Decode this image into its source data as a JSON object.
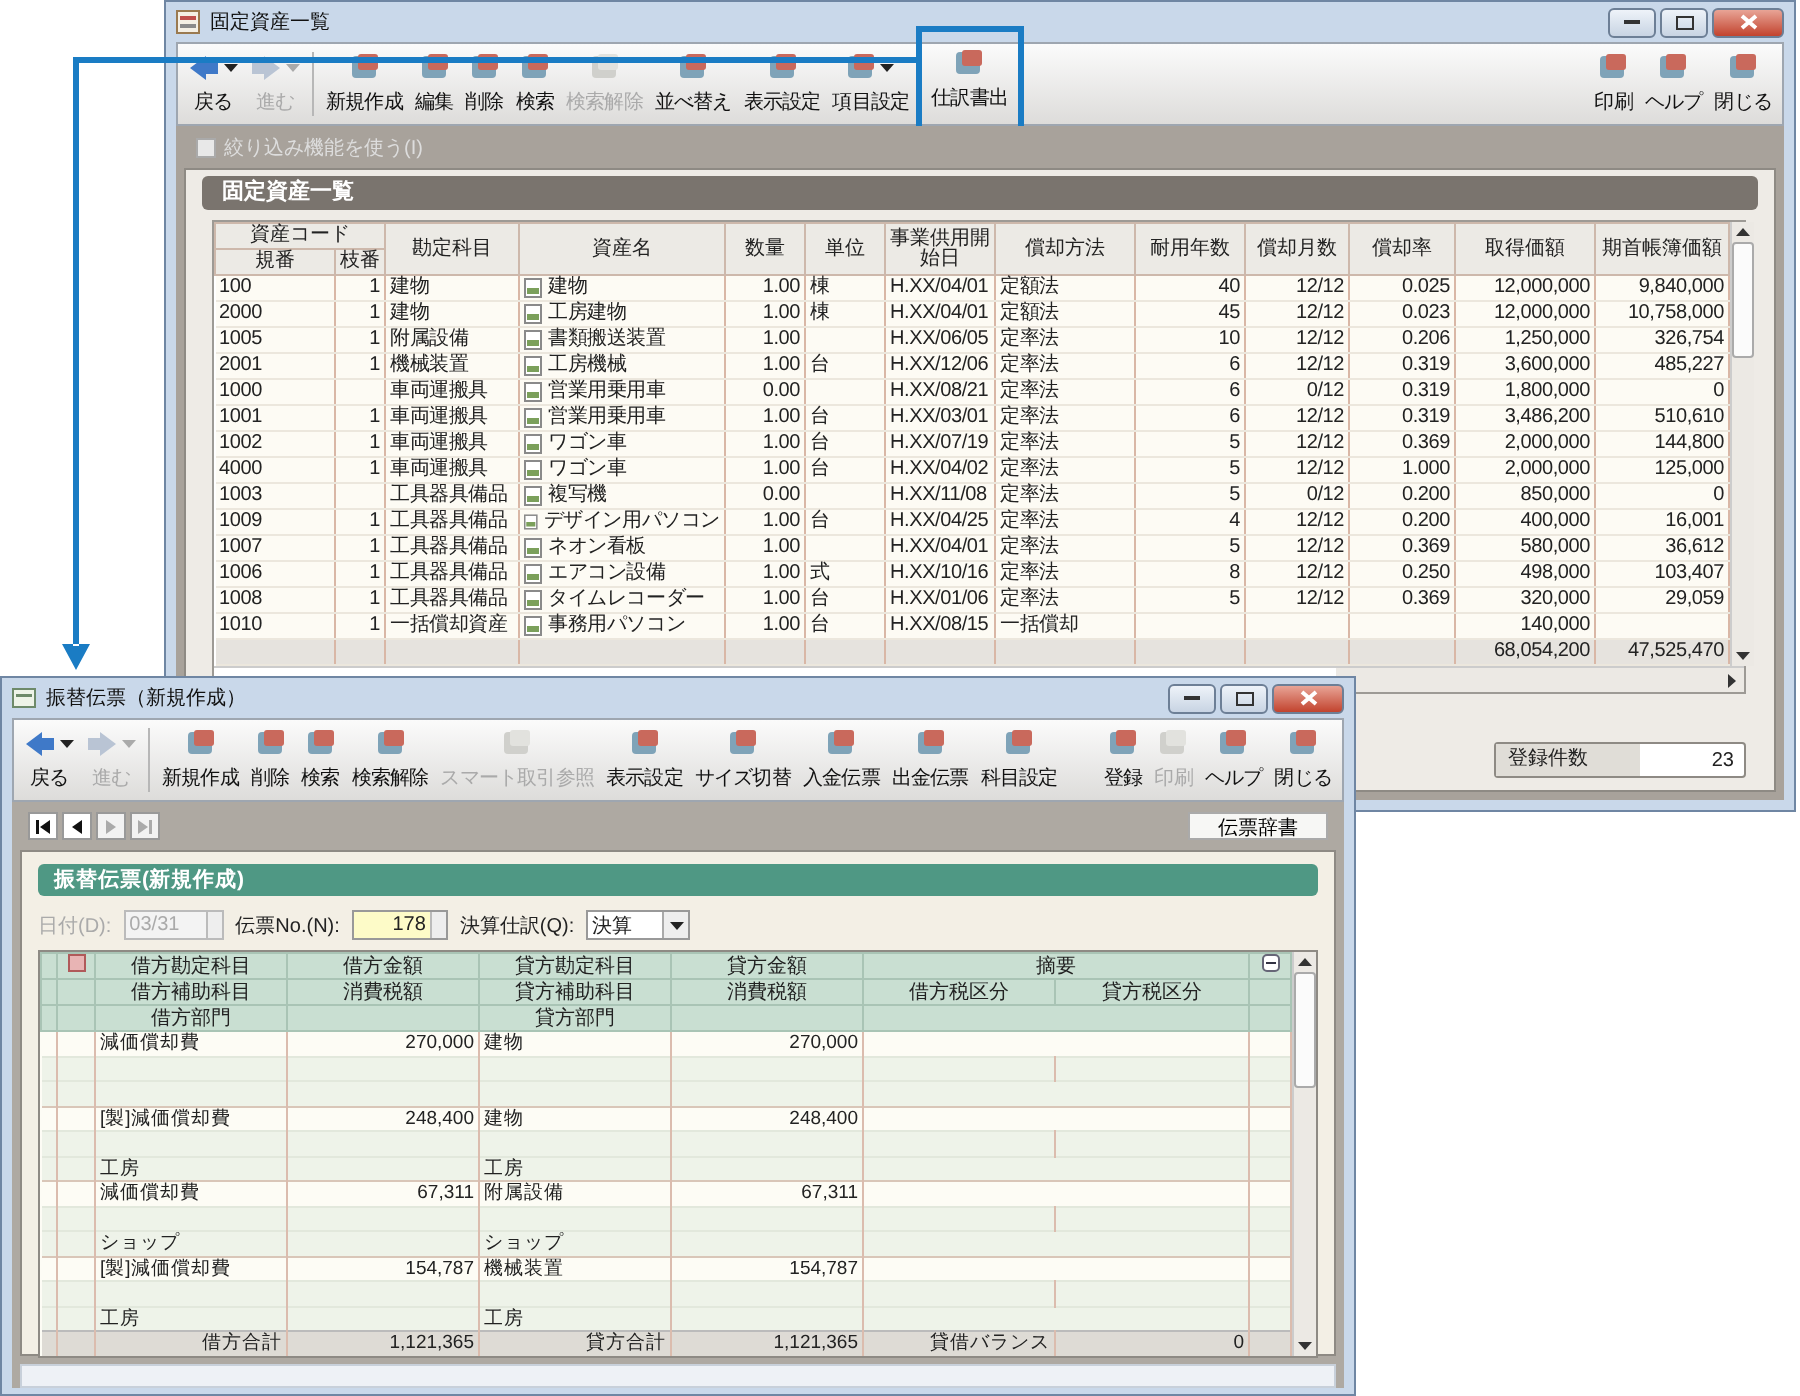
{
  "top_window": {
    "title": "固定資産一覧",
    "toolbar": {
      "left": [
        {
          "label": "戻る",
          "disabled": false,
          "has_menu": true,
          "highlighted": false
        },
        {
          "label": "進む",
          "disabled": true,
          "has_menu": true,
          "highlighted": false
        },
        {
          "label": "新規作成",
          "disabled": false,
          "has_menu": false,
          "highlighted": false
        },
        {
          "label": "編集",
          "disabled": false,
          "has_menu": false,
          "highlighted": false
        },
        {
          "label": "削除",
          "disabled": false,
          "has_menu": false,
          "highlighted": false
        },
        {
          "label": "検索",
          "disabled": false,
          "has_menu": false,
          "highlighted": false
        },
        {
          "label": "検索解除",
          "disabled": true,
          "has_menu": false,
          "highlighted": false
        },
        {
          "label": "並べ替え",
          "disabled": false,
          "has_menu": false,
          "highlighted": false
        },
        {
          "label": "表示設定",
          "disabled": false,
          "has_menu": false,
          "highlighted": false
        },
        {
          "label": "項目設定",
          "disabled": false,
          "has_menu": true,
          "highlighted": false
        },
        {
          "label": "仕訳書出",
          "disabled": false,
          "has_menu": false,
          "highlighted": true
        }
      ],
      "right": [
        {
          "label": "印刷",
          "disabled": false,
          "has_menu": false,
          "highlighted": false
        },
        {
          "label": "ヘルプ",
          "disabled": false,
          "has_menu": false,
          "highlighted": false
        },
        {
          "label": "閉じる",
          "disabled": false,
          "has_menu": false,
          "highlighted": false
        }
      ]
    },
    "filter_checkbox": {
      "label": "絞り込み機能を使う(I)",
      "checked": false,
      "disabled": true
    },
    "section_title": "固定資産一覧",
    "table": {
      "header_group": "資産コード",
      "columns": [
        "規番",
        "枝番",
        "勘定科目",
        "資産名",
        "数量",
        "単位",
        "事業供用開始日",
        "償却方法",
        "耐用年数",
        "償却月数",
        "償却率",
        "取得価額",
        "期首帳簿価額"
      ],
      "rows": [
        [
          "100",
          "1",
          "建物",
          "建物",
          "1.00",
          "棟",
          "H.XX/04/01",
          "定額法",
          "40",
          "12/12",
          "0.025",
          "12,000,000",
          "9,840,000"
        ],
        [
          "2000",
          "1",
          "建物",
          "工房建物",
          "1.00",
          "棟",
          "H.XX/04/01",
          "定額法",
          "45",
          "12/12",
          "0.023",
          "12,000,000",
          "10,758,000"
        ],
        [
          "1005",
          "1",
          "附属設備",
          "書類搬送装置",
          "1.00",
          null,
          "H.XX/06/05",
          "定率法",
          "10",
          "12/12",
          "0.206",
          "1,250,000",
          "326,754"
        ],
        [
          "2001",
          "1",
          "機械装置",
          "工房機械",
          "1.00",
          "台",
          "H.XX/12/06",
          "定率法",
          "6",
          "12/12",
          "0.319",
          "3,600,000",
          "485,227"
        ],
        [
          "1000",
          null,
          "車両運搬具",
          "営業用乗用車",
          "0.00",
          null,
          "H.XX/08/21",
          "定率法",
          "6",
          "0/12",
          "0.319",
          "1,800,000",
          "0"
        ],
        [
          "1001",
          "1",
          "車両運搬具",
          "営業用乗用車",
          "1.00",
          "台",
          "H.XX/03/01",
          "定率法",
          "6",
          "12/12",
          "0.319",
          "3,486,200",
          "510,610"
        ],
        [
          "1002",
          "1",
          "車両運搬具",
          "ワゴン車",
          "1.00",
          "台",
          "H.XX/07/19",
          "定率法",
          "5",
          "12/12",
          "0.369",
          "2,000,000",
          "144,800"
        ],
        [
          "4000",
          "1",
          "車両運搬具",
          "ワゴン車",
          "1.00",
          "台",
          "H.XX/04/02",
          "定率法",
          "5",
          "12/12",
          "1.000",
          "2,000,000",
          "125,000"
        ],
        [
          "1003",
          null,
          "工具器具備品",
          "複写機",
          "0.00",
          null,
          "H.XX/11/08",
          "定率法",
          "5",
          "0/12",
          "0.200",
          "850,000",
          "0"
        ],
        [
          "1009",
          "1",
          "工具器具備品",
          "デザイン用パソコン",
          "1.00",
          "台",
          "H.XX/04/25",
          "定率法",
          "4",
          "12/12",
          "0.200",
          "400,000",
          "16,001"
        ],
        [
          "1007",
          "1",
          "工具器具備品",
          "ネオン看板",
          "1.00",
          null,
          "H.XX/04/01",
          "定率法",
          "5",
          "12/12",
          "0.369",
          "580,000",
          "36,612"
        ],
        [
          "1006",
          "1",
          "工具器具備品",
          "エアコン設備",
          "1.00",
          "式",
          "H.XX/10/16",
          "定率法",
          "8",
          "12/12",
          "0.250",
          "498,000",
          "103,407"
        ],
        [
          "1008",
          "1",
          "工具器具備品",
          "タイムレコーダー",
          "1.00",
          "台",
          "H.XX/01/06",
          "定率法",
          "5",
          "12/12",
          "0.369",
          "320,000",
          "29,059"
        ],
        [
          "1010",
          "1",
          "一括償却資産",
          "事務用パソコン",
          "1.00",
          "台",
          "H.XX/08/15",
          "一括償却",
          null,
          null,
          null,
          "140,000",
          null
        ]
      ],
      "totals": {
        "acquisition_cost": "68,054,200",
        "opening_book_value": "47,525,470"
      }
    },
    "record_count": {
      "label": "登録件数",
      "value": "23"
    }
  },
  "bottom_window": {
    "title": "振替伝票（新規作成）",
    "toolbar": {
      "left": [
        {
          "label": "戻る",
          "disabled": false,
          "has_menu": true,
          "highlighted": false
        },
        {
          "label": "進む",
          "disabled": true,
          "has_menu": true,
          "highlighted": false
        },
        {
          "label": "新規作成",
          "disabled": false,
          "has_menu": false,
          "highlighted": false
        },
        {
          "label": "削除",
          "disabled": false,
          "has_menu": false,
          "highlighted": false
        },
        {
          "label": "検索",
          "disabled": false,
          "has_menu": false,
          "highlighted": false
        },
        {
          "label": "検索解除",
          "disabled": false,
          "has_menu": false,
          "highlighted": false
        },
        {
          "label": "スマート取引参照",
          "disabled": true,
          "has_menu": false,
          "highlighted": false
        },
        {
          "label": "表示設定",
          "disabled": false,
          "has_menu": false,
          "highlighted": false
        },
        {
          "label": "サイズ切替",
          "disabled": false,
          "has_menu": false,
          "highlighted": false
        },
        {
          "label": "入金伝票",
          "disabled": false,
          "has_menu": false,
          "highlighted": false
        },
        {
          "label": "出金伝票",
          "disabled": false,
          "has_menu": false,
          "highlighted": false
        },
        {
          "label": "科目設定",
          "disabled": false,
          "has_menu": false,
          "highlighted": false
        }
      ],
      "right": [
        {
          "label": "登録",
          "disabled": false,
          "has_menu": false,
          "highlighted": false
        },
        {
          "label": "印刷",
          "disabled": true,
          "has_menu": false,
          "highlighted": false
        },
        {
          "label": "ヘルプ",
          "disabled": false,
          "has_menu": false,
          "highlighted": false
        },
        {
          "label": "閉じる",
          "disabled": false,
          "has_menu": false,
          "highlighted": false
        }
      ]
    },
    "record_nav": [
      {
        "kind": "first",
        "disabled": false
      },
      {
        "kind": "prev",
        "disabled": false
      },
      {
        "kind": "next",
        "disabled": true
      },
      {
        "kind": "last",
        "disabled": true
      }
    ],
    "dictionary_button": "伝票辞書",
    "section_title": "振替伝票(新規作成)",
    "form": {
      "date": {
        "label": "日付(D):",
        "value": "03/31",
        "disabled": true
      },
      "slip_no": {
        "label": "伝票No.(N):",
        "value": "178"
      },
      "closing_entry": {
        "label": "決算仕訳(Q):",
        "value": "決算"
      }
    },
    "journal": {
      "header": {
        "debit_account": "借方勘定科目",
        "debit_amount": "借方金額",
        "credit_account": "貸方勘定科目",
        "credit_amount": "貸方金額",
        "summary": "摘要",
        "debit_sub_account": "借方補助科目",
        "debit_tax": "消費税額",
        "credit_sub_account": "貸方補助科目",
        "credit_tax": "消費税額",
        "debit_tax_class": "借方税区分",
        "credit_tax_class": "貸方税区分",
        "debit_department": "借方部門",
        "credit_department": "貸方部門"
      },
      "entries": [
        {
          "debit_account": "減価償却費",
          "debit_amount": "270,000",
          "credit_account": "建物",
          "credit_amount": "270,000"
        },
        {
          "debit_account": "[製]減価償却費",
          "debit_amount": "248,400",
          "credit_account": "建物",
          "credit_amount": "248,400",
          "debit_department": "工房",
          "credit_department": "工房"
        },
        {
          "debit_account": "減価償却費",
          "debit_amount": "67,311",
          "credit_account": "附属設備",
          "credit_amount": "67,311",
          "debit_department": "ショップ",
          "credit_department": "ショップ"
        },
        {
          "debit_account": "[製]減価償却費",
          "debit_amount": "154,787",
          "credit_account": "機械装置",
          "credit_amount": "154,787",
          "debit_department": "工房",
          "credit_department": "工房"
        }
      ],
      "totals": {
        "debit_label": "借方合計",
        "debit_total": "1,121,365",
        "credit_label": "貸方合計",
        "credit_total": "1,121,365",
        "balance_label": "貸借バランス",
        "balance": "0"
      }
    }
  }
}
